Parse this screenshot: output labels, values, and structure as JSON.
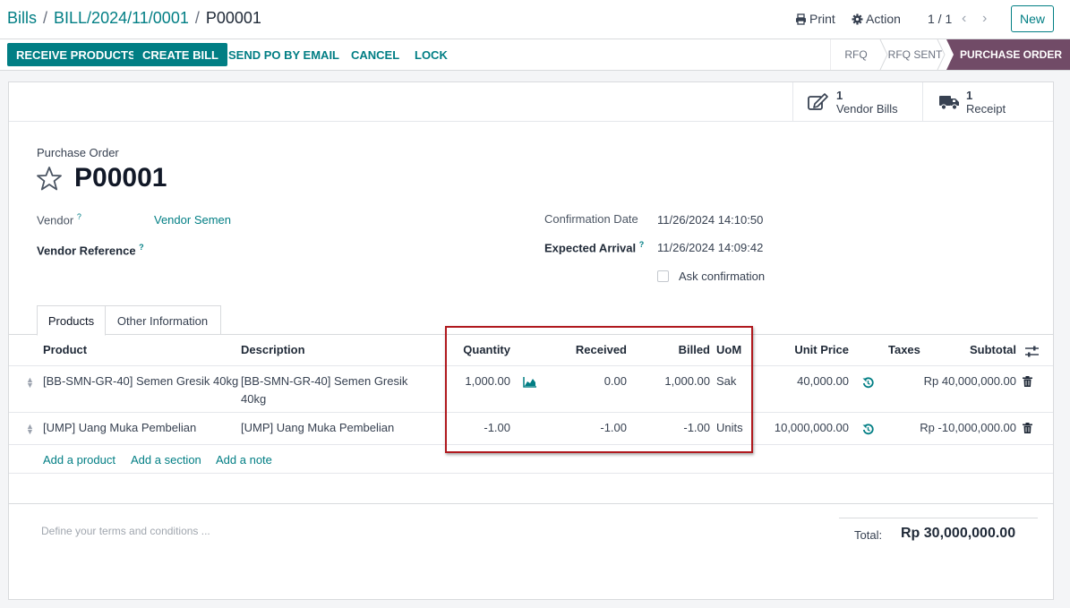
{
  "breadcrumb": {
    "root": "Bills",
    "parent": "BILL/2024/11/0001",
    "current": "P00001"
  },
  "toolbar": {
    "print": "Print",
    "action": "Action",
    "pager": "1 / 1",
    "new": "New"
  },
  "actions": {
    "receive": "RECEIVE PRODUCTS",
    "create_bill": "CREATE BILL",
    "send": "SEND PO BY EMAIL",
    "cancel": "CANCEL",
    "lock": "LOCK"
  },
  "statusbar": [
    {
      "label": "RFQ"
    },
    {
      "label": "RFQ SENT"
    },
    {
      "label": "PURCHASE ORDER",
      "active": true
    }
  ],
  "smart_buttons": [
    {
      "count": "1",
      "label": "Vendor Bills",
      "icon": "edit-icon"
    },
    {
      "count": "1",
      "label": "Receipt",
      "icon": "truck-icon"
    }
  ],
  "form": {
    "subtitle": "Purchase Order",
    "name": "P00001",
    "vendor_label": "Vendor",
    "vendor": "Vendor Semen",
    "vendor_ref_label": "Vendor Reference",
    "confirmation_label": "Confirmation Date",
    "confirmation": "11/26/2024 14:10:50",
    "expected_label": "Expected Arrival",
    "expected": "11/26/2024 14:09:42",
    "ask_label": "Ask confirmation",
    "help": "?"
  },
  "tabs": [
    {
      "label": "Products",
      "active": true
    },
    {
      "label": "Other Information"
    }
  ],
  "table": {
    "headers": {
      "product": "Product",
      "description": "Description",
      "quantity": "Quantity",
      "received": "Received",
      "billed": "Billed",
      "uom": "UoM",
      "unit_price": "Unit Price",
      "taxes": "Taxes",
      "subtotal": "Subtotal"
    },
    "rows": [
      {
        "product": "[BB-SMN-GR-40] Semen Gresik 40kg",
        "description": "[BB-SMN-GR-40] Semen Gresik 40kg",
        "quantity": "1,000.00",
        "received": "0.00",
        "billed": "1,000.00",
        "uom": "Sak",
        "unit_price": "40,000.00",
        "subtotal": "Rp 40,000,000.00"
      },
      {
        "product": "[UMP] Uang Muka Pembelian",
        "description": "[UMP] Uang Muka Pembelian",
        "quantity": "-1.00",
        "received": "-1.00",
        "billed": "-1.00",
        "uom": "Units",
        "unit_price": "10,000,000.00",
        "subtotal": "Rp -10,000,000.00"
      }
    ],
    "add_product": "Add a product",
    "add_section": "Add a section",
    "add_note": "Add a note"
  },
  "terms_placeholder": "Define your terms and conditions ...",
  "total": {
    "label": "Total:",
    "value": "Rp 30,000,000.00"
  },
  "colors": {
    "accent": "#017e84",
    "status_active": "#714b67",
    "highlight": "#b0191e"
  }
}
